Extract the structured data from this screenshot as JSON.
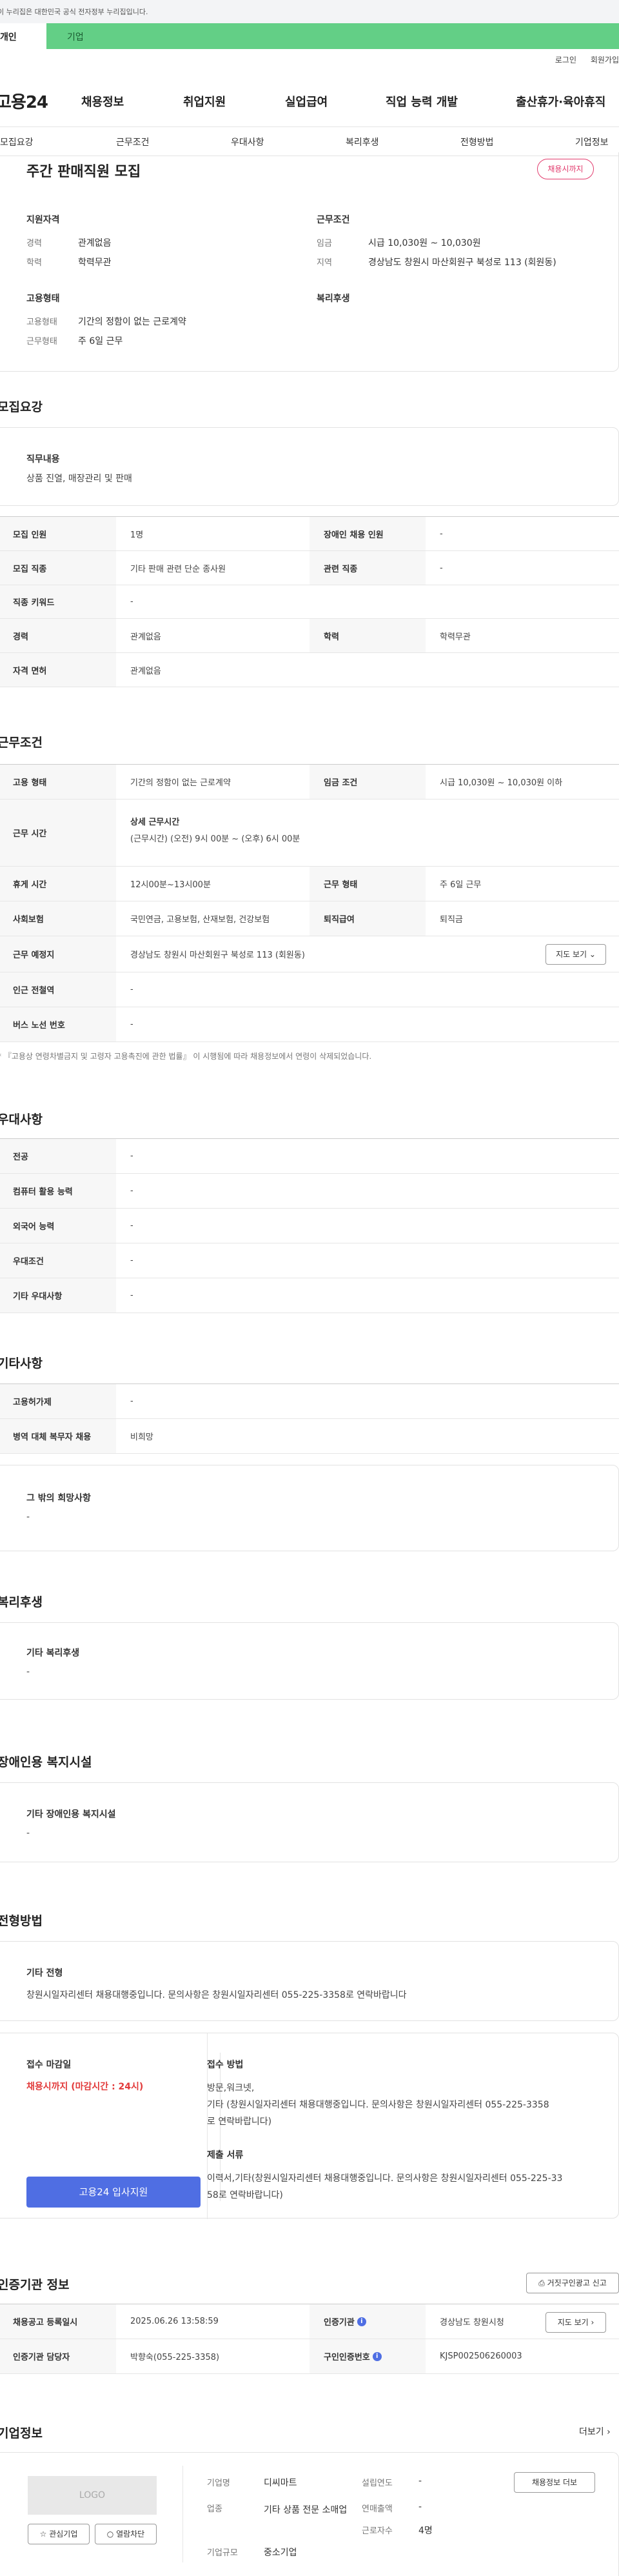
{
  "gov_notice": "이 누리집은 대한민국 공식 전자정부 누리집입니다.",
  "tabs": {
    "personal": "개인",
    "company": "기업"
  },
  "util": {
    "login": "로그인",
    "join": "회원가입"
  },
  "gnb": {
    "logo": "고용24",
    "items": [
      "채용정보",
      "취업지원",
      "실업급여",
      "직업 능력 개발",
      "출산휴가·육아휴직"
    ]
  },
  "subnav": [
    "모집요강",
    "근무조건",
    "우대사항",
    "복리후생",
    "전형방법",
    "기업정보"
  ],
  "summary": {
    "title": "주간 판매직원 모집",
    "badge": "채용시까지",
    "qual_heading": "지원자격",
    "qual": [
      {
        "label": "경력",
        "value": "관계없음"
      },
      {
        "label": "학력",
        "value": "학력무관"
      }
    ],
    "cond_heading": "근무조건",
    "cond": [
      {
        "label": "임금",
        "value": "시급 10,030원 ~ 10,030원"
      },
      {
        "label": "지역",
        "value": "경상남도 창원시 마산회원구 북성로 113 (회원동)"
      }
    ],
    "emp_heading": "고용형태",
    "emp": [
      {
        "label": "고용형태",
        "value": "기간의 정함이 없는 근로계약"
      },
      {
        "label": "근무형태",
        "value": "주 6일 근무"
      }
    ],
    "welfare_heading": "복리후생"
  },
  "recruit": {
    "heading": "모집요강",
    "duty_title": "직무내용",
    "duty_value": "상품 진열, 매장관리 및 판매",
    "rows": [
      {
        "l1": "모집 인원",
        "v1": "1명",
        "l2": "장애인 채용 인원",
        "v2": "-"
      },
      {
        "l1": "모집 직종",
        "v1": "기타 판매 관련 단순 종사원",
        "l2": "관련 직종",
        "v2": "-"
      },
      {
        "l1": "직종 키워드",
        "v1": "-"
      },
      {
        "l1": "경력",
        "v1": "관계없음",
        "l2": "학력",
        "v2": "학력무관"
      },
      {
        "l1": "자격 면허",
        "v1": "관계없음"
      }
    ]
  },
  "work": {
    "heading": "근무조건",
    "rows": [
      {
        "l1": "고용 형태",
        "v1": "기간의 정함이 없는 근로계약",
        "l2": "임금 조건",
        "v2": "시급 10,030원 ~ 10,030원 이하"
      },
      {
        "l1": "근무 시간",
        "v1a": "상세 근무시간",
        "v1b": "(근무시간) (오전) 9시 00분 ~ (오후) 6시 00분"
      },
      {
        "l1": "휴게 시간",
        "v1": "12시00분~13시00분",
        "l2": "근무 형태",
        "v2": "주 6일 근무"
      },
      {
        "l1": "사회보험",
        "v1": "국민연금, 고용보험, 산재보험, 건강보험",
        "l2": "퇴직급여",
        "v2": "퇴직금"
      },
      {
        "l1": "근무 예정지",
        "v1": "경상남도 창원시 마산회원구 북성로 113 (회원동)",
        "btn": "지도 보기"
      },
      {
        "l1": "인근 전철역",
        "v1": "-"
      },
      {
        "l1": "버스 노선 번호",
        "v1": "-"
      }
    ],
    "note": "* 『고용상 연령차별금지 및 고령자 고용촉진에 관한 법률』 이 시행됨에 따라 채용정보에서 연령이 삭제되었습니다."
  },
  "pref": {
    "heading": "우대사항",
    "rows": [
      {
        "l": "전공",
        "v": "-"
      },
      {
        "l": "컴퓨터 활용 능력",
        "v": "-"
      },
      {
        "l": "외국어 능력",
        "v": "-"
      },
      {
        "l": "우대조건",
        "v": "-"
      },
      {
        "l": "기타 우대사항",
        "v": "-"
      }
    ]
  },
  "etc": {
    "heading": "기타사항",
    "rows": [
      {
        "l": "고용허가제",
        "v": "-"
      },
      {
        "l": "병역 대체 복무자 채용",
        "v": "비희망"
      }
    ],
    "box_title": "그 밖의 희망사항",
    "box_value": "-"
  },
  "welfare": {
    "heading": "복리후생",
    "box_title": "기타 복리후생",
    "box_value": "-"
  },
  "disability": {
    "heading": "장애인용 복지시설",
    "box_title": "기타 장애인용 복지시설",
    "box_value": "-"
  },
  "selection": {
    "heading": "전형방법",
    "box_title": "기타 전형",
    "box_value": "창원시일자리센터 채용대행중입니다. 문의사항은 창원시일자리센터 055-225-3358로 연락바랍니다",
    "deadline_title": "접수 마감일",
    "deadline_value": "채용시까지 (마감시간 : 24시)",
    "apply_button": "고용24 입사지원",
    "method_title": "접수 방법",
    "method_lines": [
      "방문,워크넷,",
      "기타 (창원시일자리센터 채용대행중입니다. 문의사항은 창원시일자리센터 055-225-3358",
      "로 연락바랍니다)"
    ],
    "docs_title": "제출 서류",
    "docs_lines": [
      "이력서,기타(창원시일자리센터 채용대행중입니다. 문의사항은 창원시일자리센터 055-225-33",
      "58로 연락바랍니다)"
    ]
  },
  "cert": {
    "heading": "인증기관 정보",
    "report_button": "거짓구인광고 신고",
    "rows": [
      {
        "l1": "채용공고 등록일시",
        "v1": "2025.06.26 13:58:59",
        "l2": "인증기관",
        "v2": "경상남도 창원시청",
        "btn": "지도 보기"
      },
      {
        "l1": "인증기관 담당자",
        "v1": "박향숙(055-225-3358)",
        "l2": "구인인증번호",
        "v2": "KJSP002506260003"
      }
    ],
    "info_glyph": "i"
  },
  "company": {
    "heading": "기업정보",
    "more": "더보기",
    "logo_text": "LOGO",
    "fav_button": "관심기업",
    "block_button": "열람차단",
    "fields": [
      {
        "l": "기업명",
        "v": "디씨마트"
      },
      {
        "l": "업종",
        "v": "기타 상품 전문 소매업"
      },
      {
        "l": "기업규모",
        "v": "중소기업"
      },
      {
        "l": "설립연도",
        "v": "-"
      },
      {
        "l": "연매출액",
        "v": "-"
      },
      {
        "l": "근로자수",
        "v": "4명"
      }
    ],
    "more_jobs_button": "채용정보 더보"
  }
}
